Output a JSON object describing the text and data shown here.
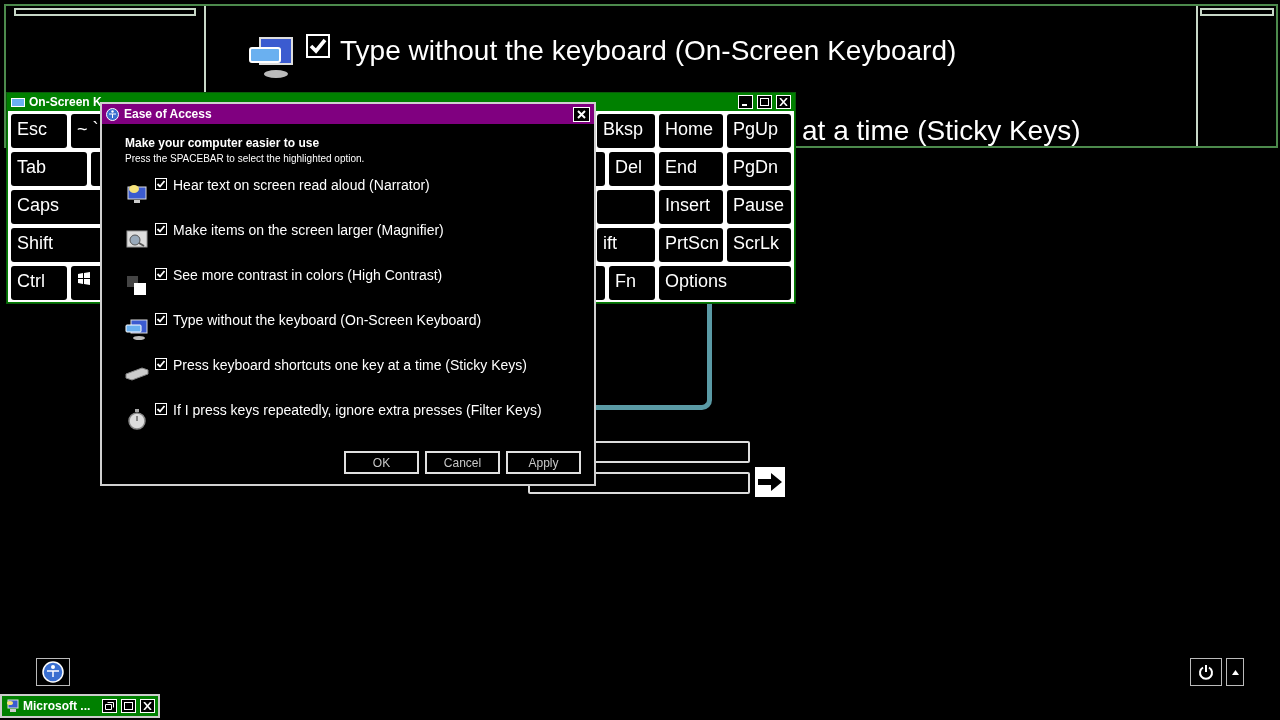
{
  "magnifier": {
    "lines": [
      {
        "kind": "option",
        "checked": true,
        "label": "Type without the keyboard (On-Screen Keyboard)"
      },
      {
        "kind": "text",
        "label": "at a time (Sticky Keys)"
      }
    ]
  },
  "keyboard": {
    "title": "On-Screen K",
    "left_rows": [
      [
        {
          "kind": "text",
          "label": "Esc"
        },
        {
          "kind": "text",
          "label": "~ `"
        }
      ],
      [
        {
          "kind": "text",
          "label": "Tab"
        },
        {
          "kind": "blank"
        }
      ],
      [
        {
          "kind": "text",
          "label": "Caps"
        }
      ],
      [
        {
          "kind": "text",
          "label": "Shift"
        }
      ],
      [
        {
          "kind": "text",
          "label": "Ctrl"
        },
        {
          "kind": "logo"
        }
      ]
    ],
    "right_rows": [
      [
        {
          "kind": "text",
          "label": "Bksp"
        },
        {
          "kind": "text",
          "label": "Home"
        },
        {
          "kind": "text",
          "label": "PgUp"
        }
      ],
      [
        {
          "kind": "blank"
        },
        {
          "kind": "text",
          "label": "Del"
        },
        {
          "kind": "text",
          "label": "End"
        },
        {
          "kind": "text",
          "label": "PgDn"
        }
      ],
      [
        {
          "kind": "blank"
        },
        {
          "kind": "text",
          "label": "Insert"
        },
        {
          "kind": "text",
          "label": "Pause"
        }
      ],
      [
        {
          "kind": "text",
          "label": "ift"
        },
        {
          "kind": "text",
          "label": "PrtScn"
        },
        {
          "kind": "text",
          "label": "ScrLk"
        }
      ],
      [
        {
          "kind": "blank"
        },
        {
          "kind": "text",
          "label": "Fn"
        },
        {
          "kind": "text",
          "label": "Options"
        }
      ]
    ]
  },
  "dialog": {
    "title": "Ease of Access",
    "heading": "Make your computer easier to use",
    "hint": "Press the SPACEBAR to select the highlighted option.",
    "options": [
      {
        "kind": "narrator",
        "checked": true,
        "label": "Hear text on screen read aloud (Narrator)"
      },
      {
        "kind": "magnifier",
        "checked": true,
        "label": "Make items on the screen larger (Magnifier)"
      },
      {
        "kind": "contrast",
        "checked": true,
        "label": "See more contrast in colors (High Contrast)"
      },
      {
        "kind": "keyboard",
        "checked": true,
        "label": "Type without the keyboard (On-Screen Keyboard)"
      },
      {
        "kind": "keys",
        "checked": true,
        "label": "Press keyboard shortcuts one key at a time (Sticky Keys)"
      },
      {
        "kind": "stopwatch",
        "checked": true,
        "label": "If I press keys repeatedly, ignore extra presses (Filter Keys)"
      }
    ],
    "buttons": [
      "OK",
      "Cancel",
      "Apply"
    ]
  },
  "taskbar_item": {
    "label": "Microsoft ..."
  }
}
